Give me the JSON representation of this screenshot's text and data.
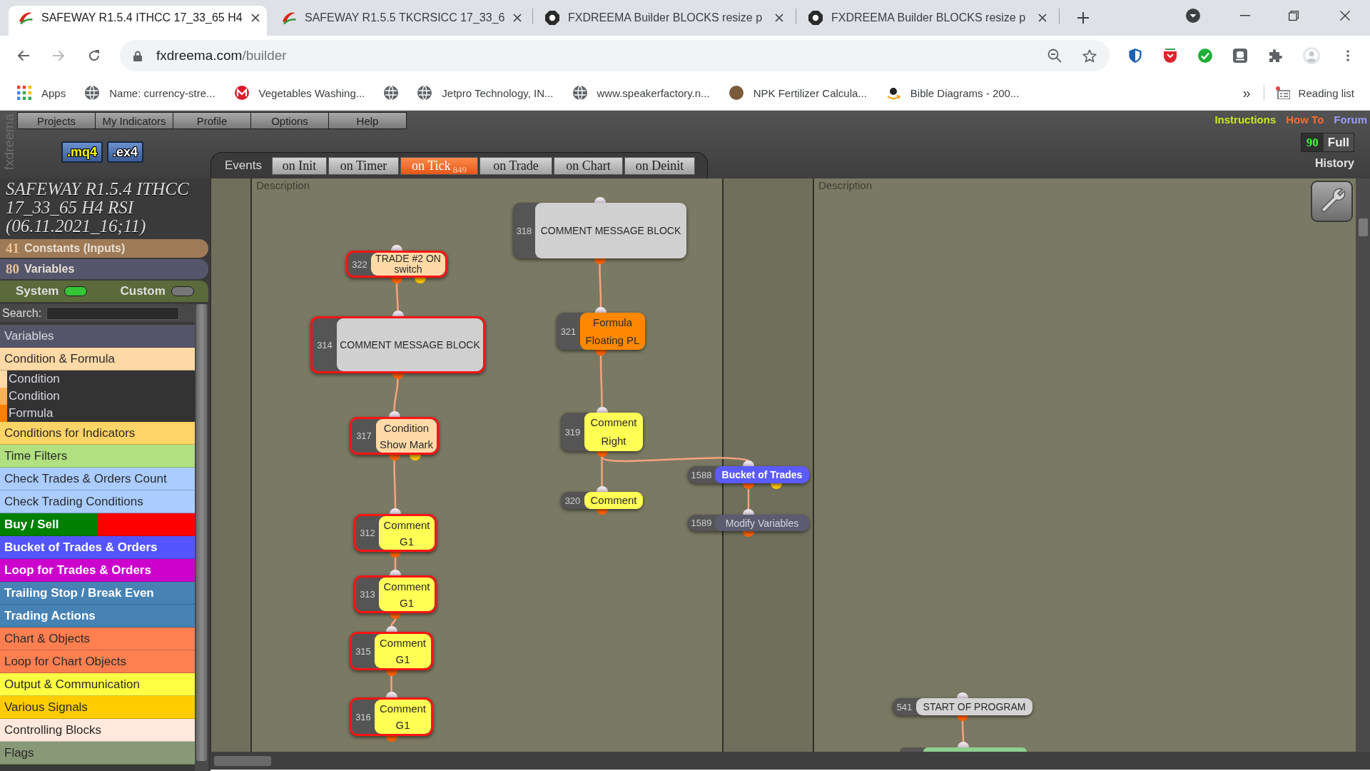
{
  "browser": {
    "tabs": [
      {
        "title": "SAFEWAY R1.5.4 ITHCC 17_33_65 H4",
        "kind": "project",
        "selected": true
      },
      {
        "title": "SAFEWAY R1.5.5 TKCRSICC 17_33_6",
        "kind": "project",
        "selected": false
      },
      {
        "title": "FXDREEMA Builder BLOCKS resize p",
        "kind": "site",
        "selected": false
      },
      {
        "title": "FXDREEMA Builder BLOCKS resize p",
        "kind": "site",
        "selected": false
      }
    ],
    "address": {
      "host": "fxdreema.com",
      "path": "/builder"
    },
    "bookmarks": [
      {
        "label": "Apps",
        "kind": "apps"
      },
      {
        "label": "Name: currency-stre...",
        "kind": "globe"
      },
      {
        "label": "Vegetables Washing...",
        "kind": "logo"
      },
      {
        "kind": "globe"
      },
      {
        "label": "Jetpro Technology, IN...",
        "kind": "globe"
      },
      {
        "label": "www.speakerfactory.n...",
        "kind": "globe"
      },
      {
        "label": "NPK Fertilizer Calcula...",
        "kind": "avatar"
      },
      {
        "label": "Bible Diagrams - 200...",
        "kind": "smile"
      }
    ],
    "more_bookmarks": "»",
    "reading_list": "Reading list"
  },
  "app": {
    "logo": "fxdreema",
    "menu": [
      "Projects",
      "My Indicators",
      "Profile",
      "Options",
      "Help"
    ],
    "export_buttons": [
      ".mq4",
      ".ex4"
    ],
    "links": [
      {
        "label": "Instructions",
        "color": "#c8e61e"
      },
      {
        "label": "How To",
        "color": "#ff6a2a"
      },
      {
        "label": "Forum",
        "color": "#9a9aff"
      }
    ],
    "history": {
      "count": "90",
      "mode": "Full",
      "title": "History"
    },
    "events": {
      "label": "Events",
      "tabs": [
        {
          "label": "on Init",
          "selected": false
        },
        {
          "label": "on Timer",
          "selected": false
        },
        {
          "label": "on Tick",
          "count": "849",
          "selected": true
        },
        {
          "label": "on Trade",
          "selected": false
        },
        {
          "label": "on Chart",
          "selected": false
        },
        {
          "label": "on Deinit",
          "selected": false
        }
      ]
    }
  },
  "sidebar": {
    "project_title": "SAFEWAY R1.5.4 ITHCC 17_33_65 H4 RSI (06.11.2021_16;11)",
    "constants": {
      "count": "41",
      "label": "Constants (Inputs)"
    },
    "variables": {
      "count": "80",
      "label": "Variables"
    },
    "toggles": [
      {
        "label": "System",
        "on": true
      },
      {
        "label": "Custom",
        "on": false
      }
    ],
    "search": {
      "label": "Search:"
    },
    "categories": [
      {
        "label": "Variables",
        "color": "#55556a"
      },
      {
        "label": "Condition & Formula",
        "color": "#ffd9a6",
        "expanded": true,
        "children": [
          {
            "label": "Condition",
            "color": "#ffd9a6"
          },
          {
            "label": "Condition",
            "color": "#ffb05a"
          },
          {
            "label": "Formula",
            "color": "#ff8000"
          }
        ]
      },
      {
        "label": "Conditions for Indicators",
        "color": "#ffd466"
      },
      {
        "label": "Time Filters",
        "color": "#b0e080"
      },
      {
        "label": "Check Trades & Orders Count",
        "color": "#aaccff"
      },
      {
        "label": "Check Trading Conditions",
        "color": "#aaccff"
      },
      {
        "label": "Buy / Sell",
        "segments": [
          {
            "color": "#008000"
          },
          {
            "color": "#ff0000"
          }
        ]
      },
      {
        "label": "Bucket of Trades & Orders",
        "color": "#5555ff"
      },
      {
        "label": "Loop for Trades & Orders",
        "color": "#cc00cc"
      },
      {
        "label": "Trailing Stop / Break Even",
        "color": "#4682b4"
      },
      {
        "label": "Trading Actions",
        "color": "#4682b4"
      },
      {
        "label": "Chart & Objects",
        "color": "#ff7f50"
      },
      {
        "label": "Loop for Chart Objects",
        "color": "#ff7f50"
      },
      {
        "label": "Output & Communication",
        "color": "#ffff44"
      },
      {
        "label": "Various Signals",
        "color": "#ffcc00"
      },
      {
        "label": "Controlling Blocks",
        "color": "#ffe8dc"
      },
      {
        "label": "Flags",
        "color": "#889977"
      }
    ]
  },
  "canvas": {
    "groups": [
      {
        "description": "Description"
      },
      {
        "description": "Description"
      }
    ],
    "blocks": [
      {
        "number": "322",
        "lines": [
          "TRADE #2 ON",
          "switch"
        ],
        "kind": "condition",
        "color": "#ffdaa8",
        "selected": true,
        "children": [
          {
            "number": "314",
            "lines": [
              "COMMENT MESSAGE BLOCK"
            ],
            "kind": "action",
            "color": "#d0d0d0",
            "selected": true,
            "children": [
              {
                "number": "317",
                "lines": [
                  "Condition",
                  "Show Mark"
                ],
                "kind": "condition",
                "color": "#ffdaa8",
                "selected": true,
                "children": [
                  {
                    "number": "312",
                    "lines": [
                      "Comment",
                      "G1"
                    ],
                    "kind": "action",
                    "color": "#ffff55",
                    "selected": true,
                    "children": [
                      {
                        "number": "313",
                        "lines": [
                          "Comment",
                          "G1"
                        ],
                        "kind": "action",
                        "color": "#ffff55",
                        "selected": true,
                        "children": [
                          {
                            "number": "315",
                            "lines": [
                              "Comment",
                              "G1"
                            ],
                            "kind": "action",
                            "color": "#ffff55",
                            "selected": true,
                            "children": [
                              {
                                "number": "316",
                                "lines": [
                                  "Comment",
                                  "G1"
                                ],
                                "kind": "action",
                                "color": "#ffff55",
                                "selected": true
                              }
                            ]
                          }
                        ]
                      }
                    ]
                  }
                ]
              }
            ]
          }
        ]
      },
      {
        "number": "318",
        "lines": [
          "COMMENT MESSAGE BLOCK"
        ],
        "kind": "action",
        "color": "#d0d0d0",
        "selected": false,
        "children": [
          {
            "number": "321",
            "lines": [
              "Formula",
              "Floating PL"
            ],
            "kind": "action",
            "color": "#ff8800",
            "selected": false,
            "children": [
              {
                "number": "319",
                "lines": [
                  "Comment",
                  "Right"
                ],
                "kind": "action",
                "color": "#ffff55",
                "selected": false,
                "children": [
                  {
                    "number": "320",
                    "lines": [
                      "Comment"
                    ],
                    "kind": "action",
                    "color": "#ffff55",
                    "selected": false
                  },
                  {
                    "number": "1588",
                    "lines": [
                      "Bucket of Trades"
                    ],
                    "kind": "condition",
                    "color": "#5b5bff",
                    "selected": false,
                    "children": [
                      {
                        "number": "1589",
                        "lines": [
                          "Modify Variables"
                        ],
                        "kind": "action",
                        "color": "#5c5c70",
                        "selected": false
                      }
                    ]
                  }
                ]
              }
            ]
          }
        ]
      },
      {
        "number": "541",
        "lines": [
          "START OF PROGRAM"
        ],
        "kind": "action",
        "color": "#d4d4d4",
        "selected": false,
        "children": [
          {
            "color": "#8fd08f",
            "selected": false
          }
        ]
      }
    ]
  }
}
